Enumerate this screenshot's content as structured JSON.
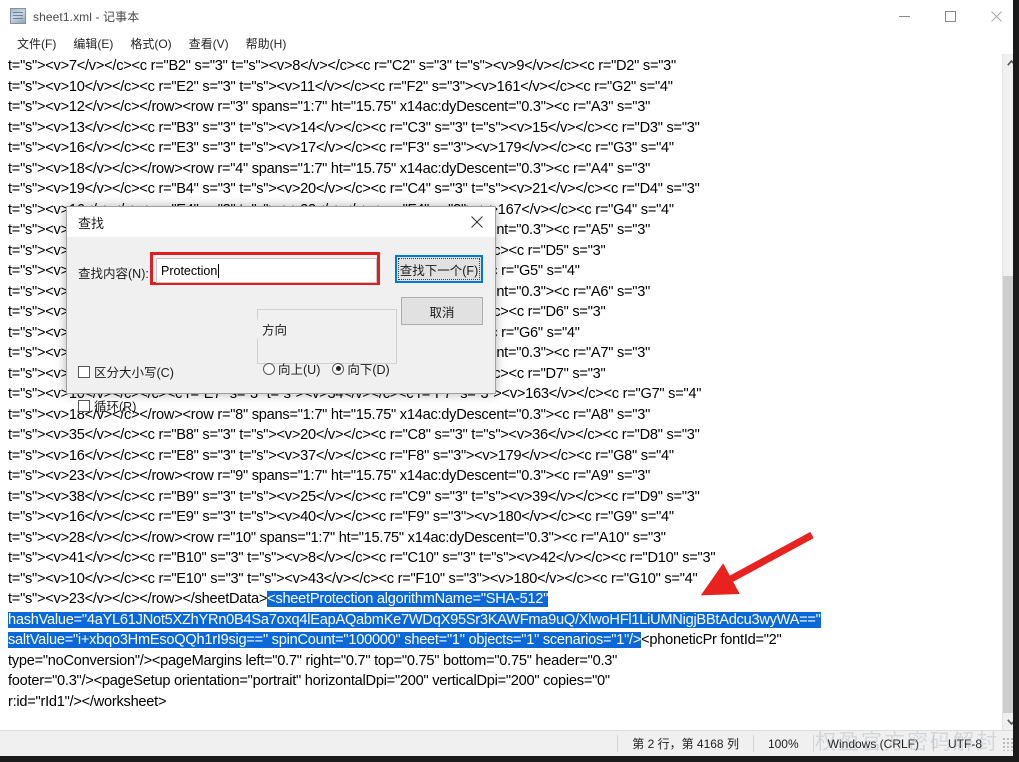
{
  "window": {
    "title": "sheet1.xml - 记事本",
    "icon": "notepad-icon",
    "minimize_label": "–",
    "maximize_label": "□",
    "close_label": "✕"
  },
  "menubar": {
    "items": [
      {
        "label": "文件(F)",
        "text": "文件",
        "accel": "F"
      },
      {
        "label": "编辑(E)",
        "text": "编辑",
        "accel": "E"
      },
      {
        "label": "格式(O)",
        "text": "格式",
        "accel": "O"
      },
      {
        "label": "查看(V)",
        "text": "查看",
        "accel": "V"
      },
      {
        "label": "帮助(H)",
        "text": "帮助",
        "accel": "H"
      }
    ]
  },
  "editor": {
    "lines": [
      "t=\"s\"><v>7</v></c><c r=\"B2\" s=\"3\" t=\"s\"><v>8</v></c><c r=\"C2\" s=\"3\" t=\"s\"><v>9</v></c><c r=\"D2\" s=\"3\"",
      "t=\"s\"><v>10</v></c><c r=\"E2\" s=\"3\" t=\"s\"><v>11</v></c><c r=\"F2\" s=\"3\"><v>161</v></c><c r=\"G2\" s=\"4\"",
      "t=\"s\"><v>12</v></c></row><row r=\"3\" spans=\"1:7\" ht=\"15.75\" x14ac:dyDescent=\"0.3\"><c r=\"A3\" s=\"3\"",
      "t=\"s\"><v>13</v></c><c r=\"B3\" s=\"3\" t=\"s\"><v>14</v></c><c r=\"C3\" s=\"3\" t=\"s\"><v>15</v></c><c r=\"D3\" s=\"3\"",
      "t=\"s\"><v>16</v></c><c r=\"E3\" s=\"3\" t=\"s\"><v>17</v></c><c r=\"F3\" s=\"3\"><v>179</v></c><c r=\"G3\" s=\"4\"",
      "t=\"s\"><v>18</v></c></row><row r=\"4\" spans=\"1:7\" ht=\"15.75\" x14ac:dyDescent=\"0.3\"><c r=\"A4\" s=\"3\"",
      "t=\"s\"><v>19</v></c><c r=\"B4\" s=\"3\" t=\"s\"><v>20</v></c><c r=\"C4\" s=\"3\" t=\"s\"><v>21</v></c><c r=\"D4\" s=\"3\"",
      "t=\"s\"><v>16</v></c><c r=\"E4\" s=\"3\" t=\"s\"><v>22</v></c><c r=\"F4\" s=\"3\"><v>167</v></c><c r=\"G4\" s=\"4\"",
      "t=\"s\"><v>24</v></c></row><row r=\"5\" spans=\"1:7\" ht=\"15.75\" x14ac:dyDescent=\"0.3\"><c r=\"A5\" s=\"3\"",
      "t=\"s\"><v>25</v></c><c r=\"B5\" s=\"3\" t=\"s\"><c r=\"C5\" s=\"3\" t=\"s\"><v>26</v></c><c r=\"D5\" s=\"3\"",
      "t=\"s\"><v>16</v></c><c r=\"E5\" s=\"3\" t=\"s\"><c r=\"F5\" s=\"3\"><v>163</v></c><c r=\"G5\" s=\"4\"",
      "t=\"s\"><v>28</v></c></row><row r=\"6\" spans=\"1:7\" ht=\"15.75\" x14ac:dyDescent=\"0.3\"><c r=\"A6\" s=\"3\"",
      "t=\"s\"><v>29</v></c><c r=\"B6\" s=\"3\" t=\"s\"><c r=\"C6\" s=\"3\" t=\"s\"><v>30</v></c><c r=\"D6\" s=\"3\"",
      "t=\"s\"><v>31</v></c><c r=\"E6\" s=\"3\" t=\"s\"><c r=\"F6\" s=\"3\"><v>170</v></c><c r=\"G6\" s=\"4\"",
      "t=\"s\"><v>32</v></c></row><row r=\"7\" spans=\"1:7\" ht=\"15.75\" x14ac:dyDescent=\"0.3\"><c r=\"A7\" s=\"3\"",
      "t=\"s\"><v>10</v></c><c r=\"B7\" s=\"3\" t=\"s\"><c r=\"C7\" s=\"3\" t=\"s\"><v>33</v></c><c r=\"D7\" s=\"3\"",
      "t=\"s\"><v>10</v></c></c><c r=\"E7\" s=\"3\" t=\"s\"><v>34</v></c><c r=\"F7\" s=\"3\"><v>163</v></c><c r=\"G7\" s=\"4\"",
      "t=\"s\"><v>18</v></c></row><row r=\"8\" spans=\"1:7\" ht=\"15.75\" x14ac:dyDescent=\"0.3\"><c r=\"A8\" s=\"3\"",
      "t=\"s\"><v>35</v></c><c r=\"B8\" s=\"3\" t=\"s\"><v>20</v></c><c r=\"C8\" s=\"3\" t=\"s\"><v>36</v></c><c r=\"D8\" s=\"3\"",
      "t=\"s\"><v>16</v></c><c r=\"E8\" s=\"3\" t=\"s\"><v>37</v></c><c r=\"F8\" s=\"3\"><v>179</v></c><c r=\"G8\" s=\"4\"",
      "t=\"s\"><v>23</v></c></row><row r=\"9\" spans=\"1:7\" ht=\"15.75\" x14ac:dyDescent=\"0.3\"><c r=\"A9\" s=\"3\"",
      "t=\"s\"><v>38</v></c><c r=\"B9\" s=\"3\" t=\"s\"><v>25</v></c><c r=\"C9\" s=\"3\" t=\"s\"><v>39</v></c><c r=\"D9\" s=\"3\"",
      "t=\"s\"><v>16</v></c><c r=\"E9\" s=\"3\" t=\"s\"><v>40</v></c><c r=\"F9\" s=\"3\"><v>180</v></c><c r=\"G9\" s=\"4\"",
      "t=\"s\"><v>28</v></c></row><row r=\"10\" spans=\"1:7\" ht=\"15.75\" x14ac:dyDescent=\"0.3\"><c r=\"A10\" s=\"3\"",
      "t=\"s\"><v>41</v></c><c r=\"B10\" s=\"3\" t=\"s\"><v>8</v></c><c r=\"C10\" s=\"3\" t=\"s\"><v>42</v></c><c r=\"D10\" s=\"3\"",
      "t=\"s\"><v>10</v></c><c r=\"E10\" s=\"3\" t=\"s\"><v>43</v></c><c r=\"F10\" s=\"3\"><v>180</v></c><c r=\"G10\" s=\"4\""
    ],
    "selection_line_prefix": "t=\"s\"><v>23</v></c></row></sheetData>",
    "selection_part1": "<sheetProtection algorithmName=\"SHA-512\"",
    "selection_part2": "hashValue=\"4aYL61JNot5XZhYRn0B4Sa7oxq4lEapAQabmKe7WDqX95Sr3KAWFma9uQ/XlwoHFl1LiUMNigjBBtAdcu3wyWA==\"",
    "selection_part3": "saltValue=\"i+xbqo3HmEsoQQh1rI9sig==\" spinCount=\"100000\" sheet=\"1\" objects=\"1\" scenarios=\"1\"/>",
    "after_selection": "<phoneticPr fontId=\"2\"",
    "tail_lines": [
      "type=\"noConversion\"/><pageMargins left=\"0.7\" right=\"0.7\" top=\"0.75\" bottom=\"0.75\" header=\"0.3\"",
      "footer=\"0.3\"/><pageSetup orientation=\"portrait\" horizontalDpi=\"200\" verticalDpi=\"200\" copies=\"0\"",
      "r:id=\"rId1\"/></worksheet>"
    ],
    "selection_color": "#0a68d8"
  },
  "scrollbar": {
    "up_arrow": "⌃",
    "down_arrow": "⌄"
  },
  "statusbar": {
    "position": "第 2 行，第 4168 列",
    "zoom": "100%",
    "line_ending": "Windows (CRLF)",
    "encoding": "UTF-8",
    "watermark": "权盈官方密码解封"
  },
  "find_dialog": {
    "title": "查找",
    "close_label": "✕",
    "find_what_label": "查找内容(N):",
    "find_what_value": "Protection",
    "find_next_label": "查找下一个(F)",
    "cancel_label": "取消",
    "direction_group_label": "方向",
    "direction_up_label": "向上(U)",
    "direction_down_label": "向下(D)",
    "direction_selected": "向下(D)",
    "match_case_label": "区分大小写(C)",
    "match_case_checked": false,
    "wrap_around_label": "循环(R)",
    "wrap_around_checked": false,
    "highlight_color": "#e02020",
    "focus_color": "#0078d7"
  },
  "annotation": {
    "arrow_color": "#e8231f",
    "arrow_name": "red-pointer-arrow"
  }
}
